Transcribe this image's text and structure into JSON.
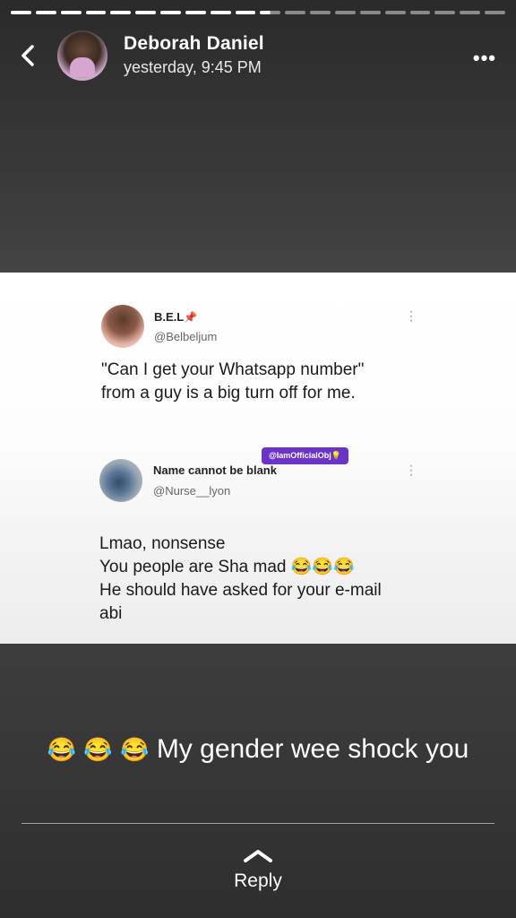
{
  "story": {
    "segments_total": 20,
    "segments_done": 11,
    "author": "Deborah Daniel",
    "timestamp": "yesterday, 9:45 PM",
    "caption": "My gender wee shock you",
    "caption_emojis": [
      "😂",
      "😂",
      "😂"
    ],
    "reply_label": "Reply"
  },
  "screenshot": {
    "tweet1": {
      "name": "B.E.L",
      "name_emoji": "📌",
      "handle": "@Belbeljum",
      "text_line1": "\"Can I get your Whatsapp number\"",
      "text_line2": "from a guy is a big turn off for me."
    },
    "tweet2": {
      "name": "Name cannot be blank",
      "handle": "@Nurse__lyon",
      "watermark": "@IamOfficialObj",
      "watermark_emoji": "💡",
      "text_line1": "Lmao, nonsense",
      "text_line2": "You people are Sha mad",
      "text_line2_emojis": "😂😂😂",
      "text_line3": "He should have asked for your e-mail",
      "text_line4": "abi"
    }
  }
}
